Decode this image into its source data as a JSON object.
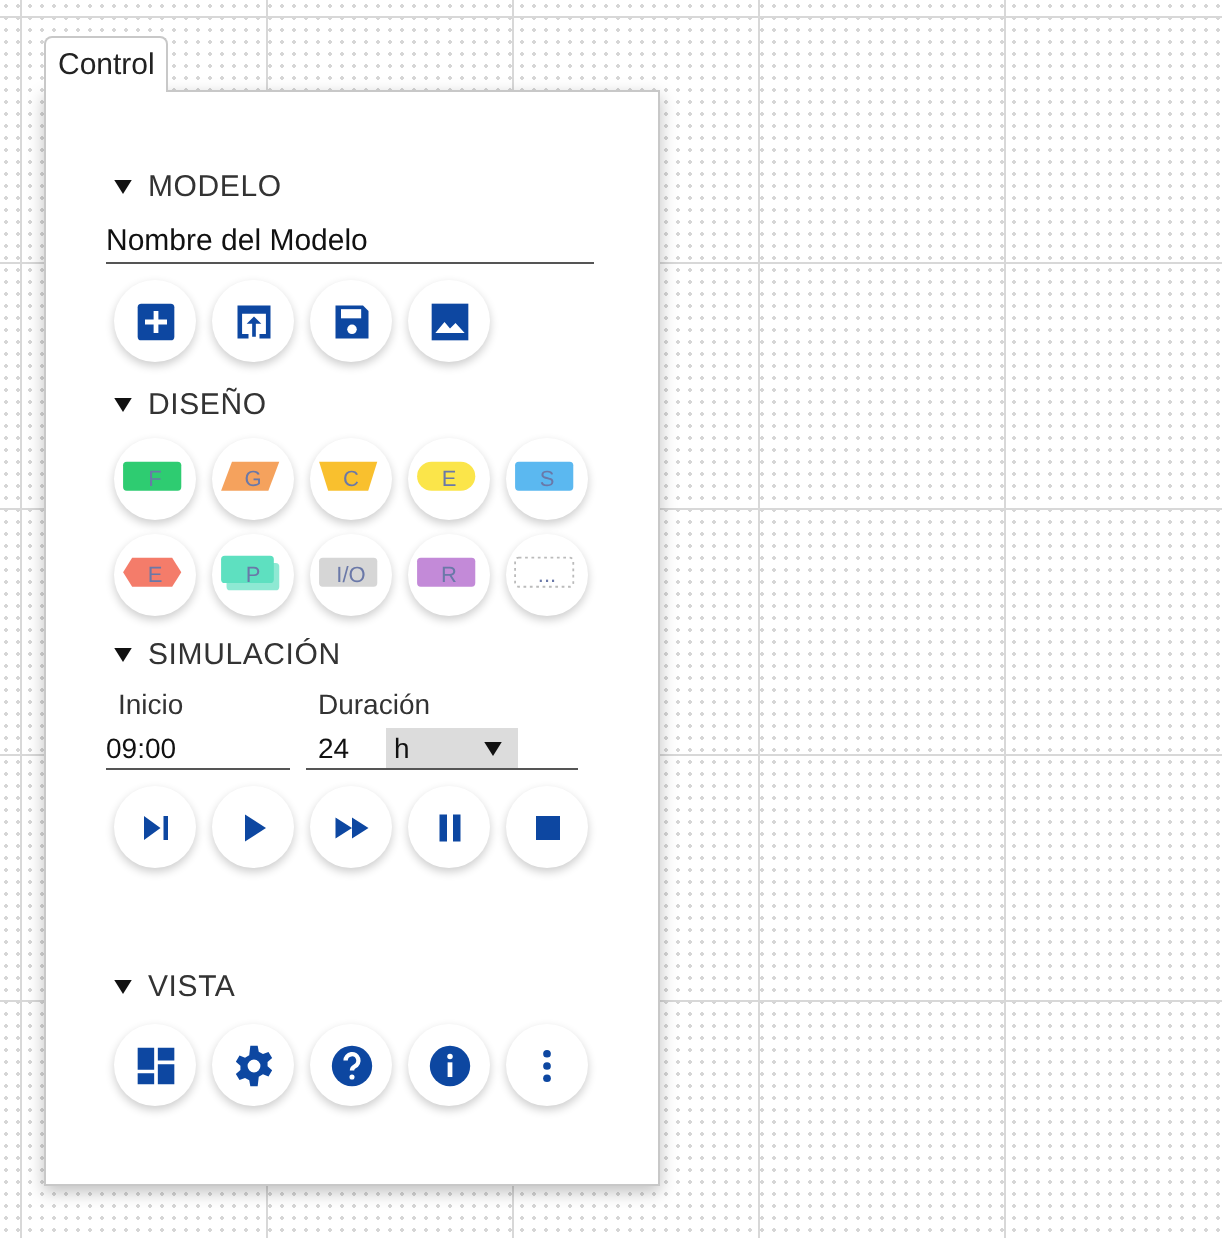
{
  "tab": {
    "label": "Control",
    "selected": true
  },
  "modelo": {
    "title": "MODELO",
    "expanded": true,
    "value": "Nombre del Modelo",
    "buttons": [
      {
        "kind": "add"
      },
      {
        "kind": "open"
      },
      {
        "kind": "save"
      },
      {
        "kind": "image"
      }
    ]
  },
  "diseno": {
    "title": "DISEÑO",
    "expanded": true,
    "shapes": [
      {
        "kind": "rect",
        "label": "F",
        "color": "#2ecc71"
      },
      {
        "kind": "parallelogram",
        "label": "G",
        "color": "#f5a25d"
      },
      {
        "kind": "trapezoid",
        "label": "C",
        "color": "#f9c02e"
      },
      {
        "kind": "pill",
        "label": "E",
        "color": "#fbe54a"
      },
      {
        "kind": "rect",
        "label": "S",
        "color": "#5bb8f0"
      },
      {
        "kind": "hexagon",
        "label": "E",
        "color": "#f47c6a"
      },
      {
        "kind": "stack",
        "label": "P",
        "color": "#5ee0c0"
      },
      {
        "kind": "rect",
        "label": "I/O",
        "color": "#d6d6d6"
      },
      {
        "kind": "rect",
        "label": "R",
        "color": "#c38ad8"
      },
      {
        "kind": "dotted",
        "label": "...",
        "color": "#bbbbbb"
      }
    ]
  },
  "simulacion": {
    "title": "SIMULACIÓN",
    "expanded": true,
    "start": {
      "label": "Inicio",
      "value": "09:00"
    },
    "duration": {
      "label": "Duración",
      "value": "24",
      "unit": "h"
    },
    "buttons": [
      {
        "kind": "step"
      },
      {
        "kind": "play"
      },
      {
        "kind": "fast"
      },
      {
        "kind": "pause"
      },
      {
        "kind": "stop"
      }
    ]
  },
  "vista": {
    "title": "VISTA",
    "expanded": true,
    "buttons": [
      {
        "kind": "layout"
      },
      {
        "kind": "settings"
      },
      {
        "kind": "help"
      },
      {
        "kind": "info"
      },
      {
        "kind": "more"
      }
    ]
  }
}
